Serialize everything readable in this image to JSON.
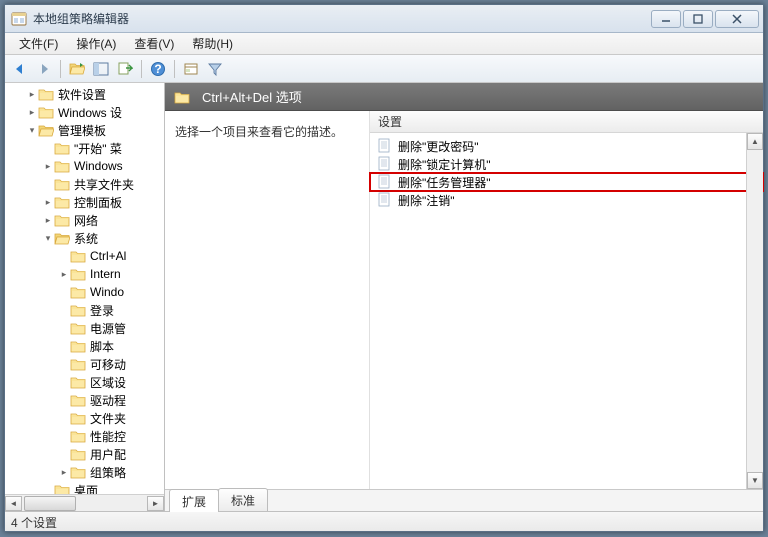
{
  "window": {
    "title": "本地组策略编辑器"
  },
  "menu": {
    "file": "文件(F)",
    "action": "操作(A)",
    "view": "查看(V)",
    "help": "帮助(H)"
  },
  "tree": {
    "items": [
      {
        "indent": 1,
        "twisty": "closed",
        "label": "软件设置"
      },
      {
        "indent": 1,
        "twisty": "closed",
        "label": "Windows 设"
      },
      {
        "indent": 1,
        "twisty": "open",
        "label": "管理模板"
      },
      {
        "indent": 2,
        "twisty": "none",
        "label": "\"开始\" 菜"
      },
      {
        "indent": 2,
        "twisty": "closed",
        "label": "Windows"
      },
      {
        "indent": 2,
        "twisty": "none",
        "label": "共享文件夹"
      },
      {
        "indent": 2,
        "twisty": "closed",
        "label": "控制面板"
      },
      {
        "indent": 2,
        "twisty": "closed",
        "label": "网络"
      },
      {
        "indent": 2,
        "twisty": "open",
        "label": "系统"
      },
      {
        "indent": 3,
        "twisty": "none",
        "label": "Ctrl+Al"
      },
      {
        "indent": 3,
        "twisty": "closed",
        "label": "Intern"
      },
      {
        "indent": 3,
        "twisty": "none",
        "label": "Windo"
      },
      {
        "indent": 3,
        "twisty": "none",
        "label": "登录"
      },
      {
        "indent": 3,
        "twisty": "none",
        "label": "电源管"
      },
      {
        "indent": 3,
        "twisty": "none",
        "label": "脚本"
      },
      {
        "indent": 3,
        "twisty": "none",
        "label": "可移动"
      },
      {
        "indent": 3,
        "twisty": "none",
        "label": "区域设"
      },
      {
        "indent": 3,
        "twisty": "none",
        "label": "驱动程"
      },
      {
        "indent": 3,
        "twisty": "none",
        "label": "文件夹"
      },
      {
        "indent": 3,
        "twisty": "none",
        "label": "性能控"
      },
      {
        "indent": 3,
        "twisty": "none",
        "label": "用户配"
      },
      {
        "indent": 3,
        "twisty": "closed",
        "label": "组策略"
      },
      {
        "indent": 2,
        "twisty": "none",
        "label": "桌面"
      }
    ]
  },
  "path": {
    "label": "Ctrl+Alt+Del 选项"
  },
  "description": {
    "hint": "选择一个项目来查看它的描述。"
  },
  "list": {
    "header": "设置",
    "items": [
      {
        "label": "删除\"更改密码\"",
        "highlight": false
      },
      {
        "label": "删除\"锁定计算机\"",
        "highlight": false
      },
      {
        "label": "删除\"任务管理器\"",
        "highlight": true
      },
      {
        "label": "删除\"注销\"",
        "highlight": false
      }
    ]
  },
  "tabs": {
    "extended": "扩展",
    "standard": "标准"
  },
  "status": {
    "text": "4 个设置"
  }
}
